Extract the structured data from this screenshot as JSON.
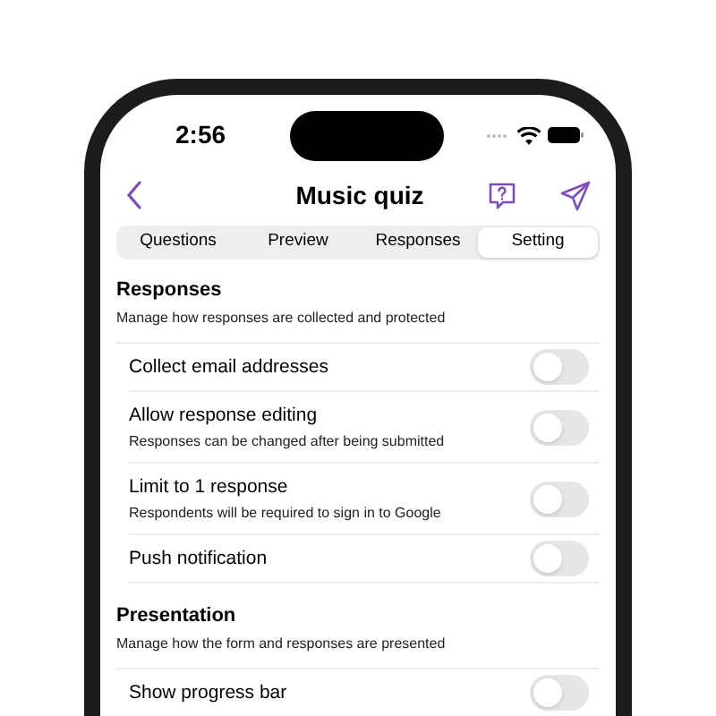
{
  "status_bar": {
    "time": "2:56"
  },
  "nav": {
    "title": "Music quiz"
  },
  "tabs": [
    {
      "label": "Questions",
      "selected": false
    },
    {
      "label": "Preview",
      "selected": false
    },
    {
      "label": "Responses",
      "selected": false
    },
    {
      "label": "Setting",
      "selected": true
    }
  ],
  "sections": [
    {
      "title": "Responses",
      "description": "Manage how responses are collected and protected",
      "items": [
        {
          "label": "Collect email addresses",
          "on": false
        },
        {
          "label": "Allow response editing",
          "sublabel": "Responses can be changed after being submitted",
          "on": false
        },
        {
          "label": "Limit to 1 response",
          "sublabel": "Respondents will be required to sign in to Google",
          "on": false
        },
        {
          "label": "Push notification",
          "on": false
        }
      ]
    },
    {
      "title": "Presentation",
      "description": "Manage how the form and responses are presented",
      "items": [
        {
          "label": "Show progress bar",
          "on": false
        }
      ]
    }
  ]
}
